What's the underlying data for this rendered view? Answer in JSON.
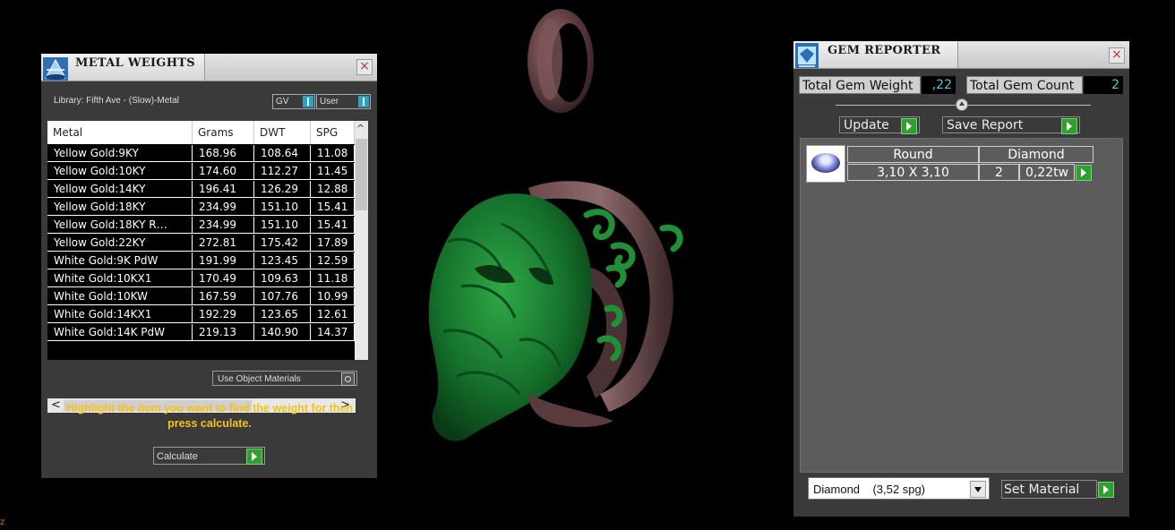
{
  "metal_weights": {
    "title": "METAL WEIGHTS",
    "close": "×",
    "library": "Library: Fifth Ave - (Slow)-Metal",
    "toggle_gv": "GV",
    "toggle_user": "User",
    "columns": [
      "Metal",
      "Grams",
      "DWT",
      "SPG"
    ],
    "rows": [
      [
        "Yellow Gold:9KY",
        "168.96",
        "108.64",
        "11.08"
      ],
      [
        "Yellow Gold:10KY",
        "174.60",
        "112.27",
        "11.45"
      ],
      [
        "Yellow Gold:14KY",
        "196.41",
        "126.29",
        "12.88"
      ],
      [
        "Yellow Gold:18KY",
        "234.99",
        "151.10",
        "15.41"
      ],
      [
        "Yellow Gold:18KY R…",
        "234.99",
        "151.10",
        "15.41"
      ],
      [
        "Yellow Gold:22KY",
        "272.81",
        "175.42",
        "17.89"
      ],
      [
        "White Gold:9K PdW",
        "191.99",
        "123.45",
        "12.59"
      ],
      [
        "White Gold:10KX1",
        "170.49",
        "109.63",
        "11.18"
      ],
      [
        "White Gold:10KW",
        "167.59",
        "107.76",
        "10.99"
      ],
      [
        "White Gold:14KX1",
        "192.29",
        "123.65",
        "12.61"
      ],
      [
        "White Gold:14K PdW",
        "219.13",
        "140.90",
        "14.37"
      ]
    ],
    "use_object_materials": "Use Object Materials",
    "hint": "Highlight the item you want to find the weight for then press calculate.",
    "calculate": "Calculate"
  },
  "gem_reporter": {
    "title": "GEM REPORTER",
    "close": "×",
    "total_weight_label": "Total Gem Weight",
    "total_weight_value": ",22",
    "total_count_label": "Total Gem Count",
    "total_count_value": "2",
    "update": "Update",
    "save_report": "Save Report",
    "gem": {
      "shape": "Round",
      "type": "Diamond",
      "size": "3,10 X 3,10",
      "count": "2",
      "weight": "0,22tw"
    },
    "material_select": "Diamond    (3,52 spg)",
    "set_material": "Set Material"
  },
  "colors": {
    "accent_green": "#2fa02f",
    "hint_yellow": "#f6c21a",
    "value_cyan": "#3fd0e0",
    "toggle_blue": "#2aa3c9"
  },
  "viewport": {
    "corner": "z"
  }
}
